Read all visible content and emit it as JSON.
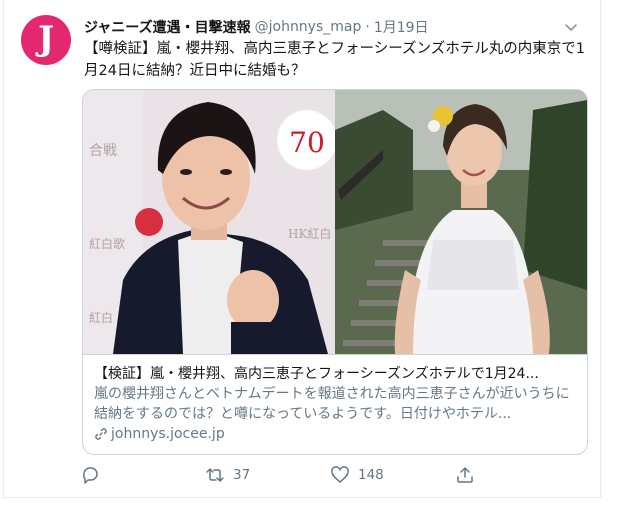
{
  "tweet": {
    "author": {
      "avatar_letter": "J",
      "name": "ジャニーズ遭遇・目撃速報",
      "handle": "@johnnys_map",
      "separator": "·",
      "date": "1月19日"
    },
    "text": "【噂検証】嵐・櫻井翔、高内三恵子とフォーシーズンズホテル丸の内東京で1月24日に結納？近日中に結婚も？",
    "card": {
      "image_text": {
        "badge_number": "70",
        "backdrop_left_1": "合戦",
        "backdrop_left_2": "紅白歌",
        "backdrop_left_3": "紅白",
        "backdrop_right": "HK紅白"
      },
      "title": "【検証】嵐・櫻井翔、高内三恵子とフォーシーズンズホテルで1月24...",
      "description": "嵐の櫻井翔さんとベトナムデートを報道された高内三恵子さんが近いうちに結納をするのでは？と噂になっているようです。日付けやホテル...",
      "link": "johnnys.jocee.jp"
    },
    "actions": {
      "reply_count": "",
      "retweet_count": "37",
      "like_count": "148"
    }
  },
  "colors": {
    "accent": "#e4286f",
    "muted": "#657786",
    "border": "#ccd6dd"
  },
  "icons": [
    "chevron-down-icon",
    "link-icon",
    "reply-icon",
    "retweet-icon",
    "like-icon",
    "share-icon"
  ]
}
